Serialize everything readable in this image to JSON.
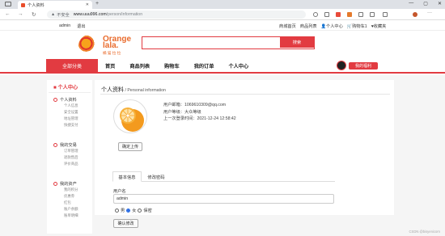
{
  "browser": {
    "tab_title": "个人资料",
    "tab_close": "✕",
    "new_tab": "+",
    "window_controls": [
      "—",
      "▢",
      "✕"
    ],
    "back": "←",
    "forward": "→",
    "reload": "↻",
    "insecure_label": "不安全",
    "url_host": "www.uuu996.com",
    "url_path": "/person/information",
    "warn_icon": "▲"
  },
  "topbar": {
    "left": [
      "admin",
      "退出"
    ],
    "right": [
      "商城首页",
      "商品列表",
      "个人中心",
      "购物车1",
      "收藏夹"
    ]
  },
  "logo": {
    "name": "Orange\nlala.",
    "sub": "橘 猫 拉 拉"
  },
  "search": {
    "placeholder": "",
    "button": "搜索"
  },
  "nav": {
    "all_categories": "全部分类",
    "links": [
      "首页",
      "商品列表",
      "购物车",
      "我的订单",
      "个人中心"
    ],
    "welfare": "我的福利"
  },
  "sidebar": {
    "title": "个人中心",
    "groups": [
      {
        "title": "个人资料",
        "items": [
          "个人信息",
          "安全设置",
          "地址管理",
          "快捷支付"
        ]
      },
      {
        "title": "我的交易",
        "items": [
          "订单管理",
          "退款售后",
          "评价商品"
        ]
      },
      {
        "title": "我的资产",
        "items": [
          "我的积分",
          "优惠券",
          "红包",
          "账户余额",
          "账单明细"
        ]
      }
    ]
  },
  "main": {
    "title": "个人资料",
    "title_en": " / Personal information",
    "upload_button": "确定上传",
    "email": "用户邮箱：1069610309@qq.com",
    "level": "用户等级：大众等级",
    "last_login": "上一次登录时间：2021-12-24 12:58:42",
    "tabs": [
      "基本信息",
      "修改密码"
    ],
    "username_label": "用户名",
    "username_value": "admin",
    "gender_options": [
      "男",
      "女",
      "保密"
    ],
    "gender_selected": "女",
    "confirm_button": "确认修改"
  },
  "watermark": "CSDN @bisyenicorn"
}
